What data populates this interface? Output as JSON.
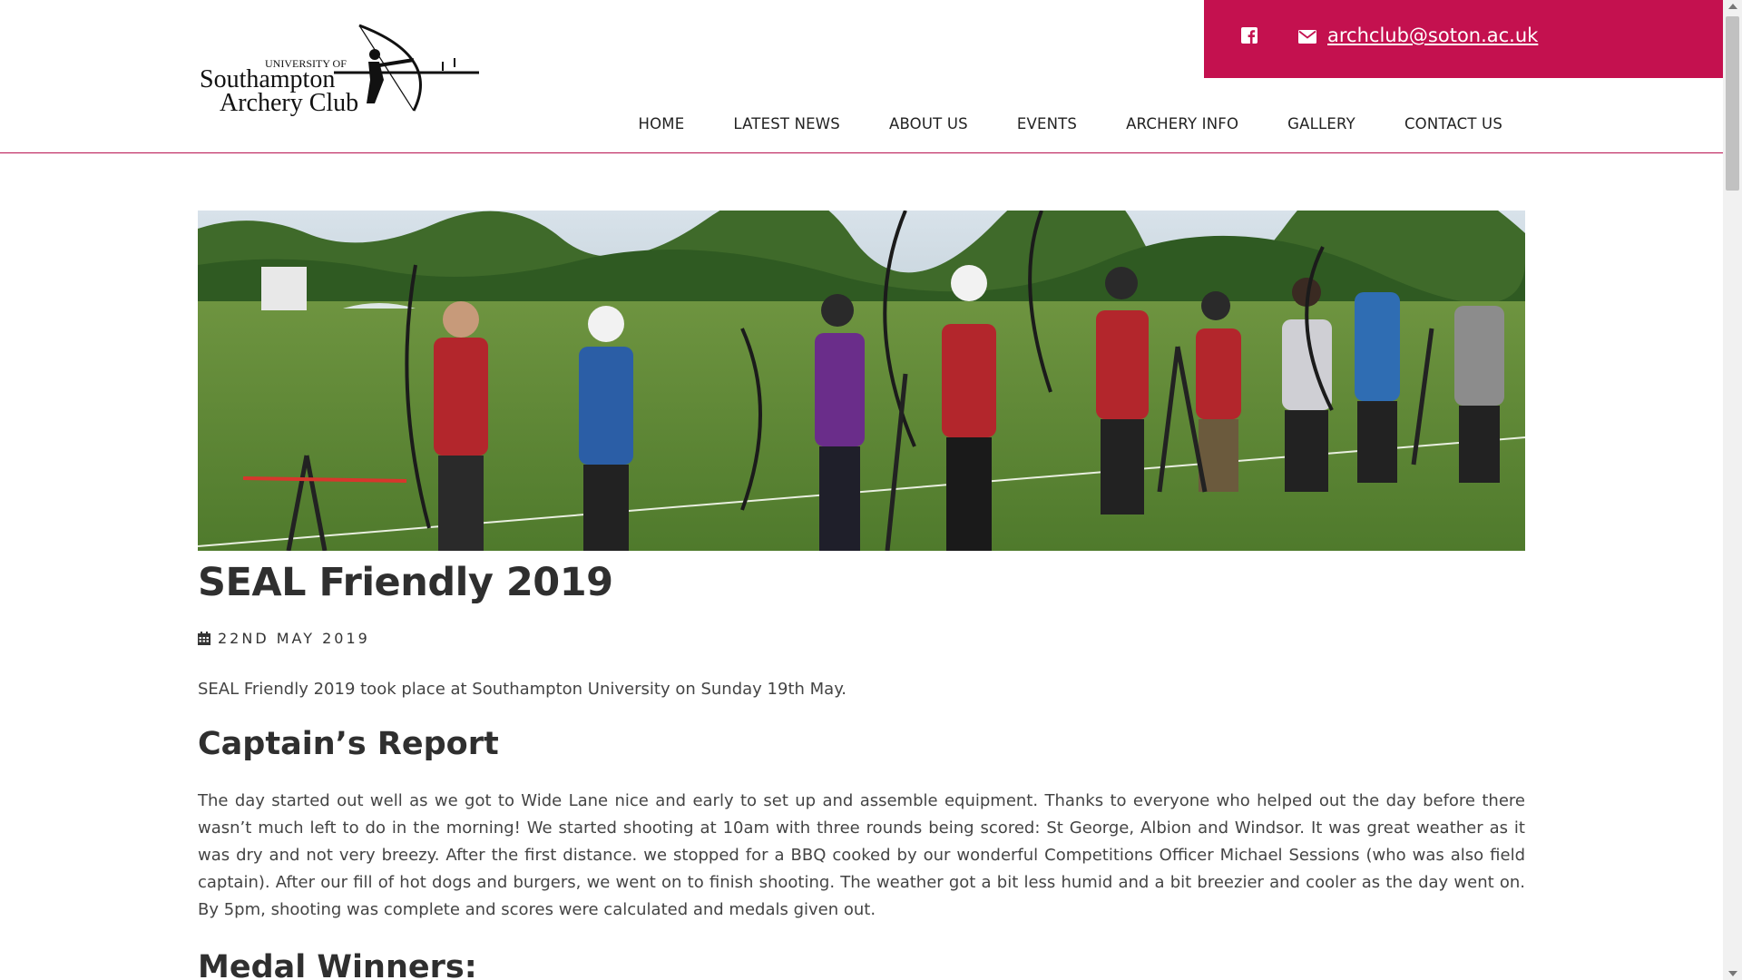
{
  "header": {
    "logo_text": {
      "line1": "UNIVERSITY OF",
      "line2": "Southampton",
      "line3": "Archery Club"
    },
    "contact_email": "archclub@soton.ac.uk",
    "social_icon": "facebook-icon",
    "mail_icon": "envelope-icon",
    "nav": [
      {
        "label": "HOME"
      },
      {
        "label": "LATEST NEWS"
      },
      {
        "label": "ABOUT US"
      },
      {
        "label": "EVENTS"
      },
      {
        "label": "ARCHERY INFO"
      },
      {
        "label": "GALLERY"
      },
      {
        "label": "CONTACT US"
      }
    ]
  },
  "post": {
    "title": "SEAL Friendly 2019",
    "date": "22ND MAY 2019",
    "date_icon": "calendar-icon",
    "intro": "SEAL Friendly 2019 took place at Southampton University on Sunday 19th May.",
    "report_heading": "Captain’s Report",
    "report_body": "The day started out well as we got to Wide Lane nice and early to set up and assemble equipment. Thanks to everyone who helped out the day before there wasn’t much left to do in the morning! We started shooting at 10am with three rounds being scored: St George, Albion and Windsor. It was great weather as it was dry and not very breezy. After the first distance. we stopped for a BBQ cooked by our wonderful Competitions Officer Michael Sessions (who was also field captain). After our fill of hot dogs and burgers, we went on to finish shooting. The weather got a bit less humid and a bit breezier and cooler as the day went on. By 5pm, shooting was complete and scores were calculated and medals given out.",
    "medals_heading": "Medal Winners:"
  },
  "colors": {
    "brand": "#c4114f",
    "text": "#333333"
  }
}
